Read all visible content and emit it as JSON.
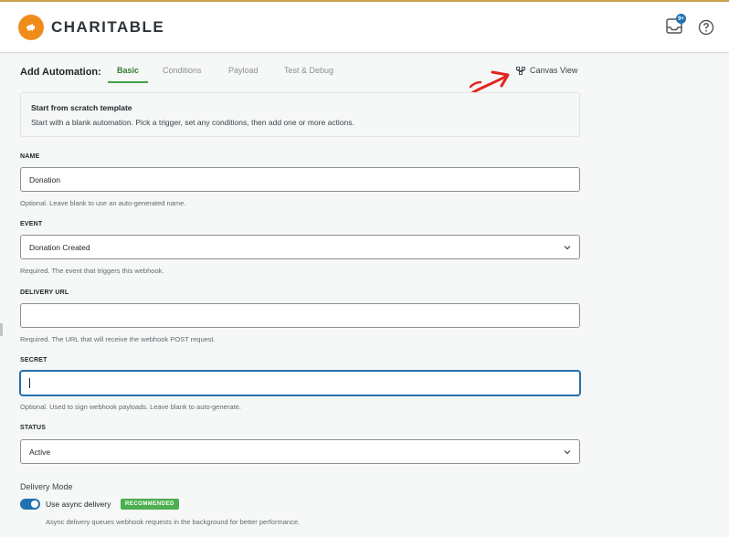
{
  "brand": {
    "name": "CHARITABLE",
    "accent": "#f08c1a"
  },
  "header": {
    "notification_count": "9+",
    "inbox_icon": "inbox-icon",
    "help_icon": "help-circle-icon"
  },
  "page": {
    "title": "Add Automation:",
    "tabs": [
      {
        "label": "Basic",
        "active": true
      },
      {
        "label": "Conditions",
        "active": false
      },
      {
        "label": "Payload",
        "active": false
      },
      {
        "label": "Test & Debug",
        "active": false
      }
    ],
    "canvas_view_label": "Canvas View"
  },
  "template": {
    "title": "Start from scratch template",
    "description": "Start with a blank automation. Pick a trigger, set any conditions, then add one or more actions."
  },
  "form": {
    "name": {
      "label": "NAME",
      "value": "Donation",
      "help": "Optional. Leave blank to use an auto-generated name."
    },
    "event": {
      "label": "EVENT",
      "value": "Donation Created",
      "help": "Required. The event that triggers this webhook."
    },
    "delivery_url": {
      "label": "DELIVERY URL",
      "value": "",
      "help": "Required. The URL that will receive the webhook POST request."
    },
    "secret": {
      "label": "SECRET",
      "value": "",
      "help": "Optional. Used to sign webhook payloads. Leave blank to auto-generate."
    },
    "status": {
      "label": "STATUS",
      "value": "Active"
    }
  },
  "delivery_mode": {
    "label": "Delivery Mode",
    "toggle_label": "Use async delivery",
    "toggle_on": true,
    "badge": "RECOMMENDED",
    "help": "Async delivery queues webhook requests in the background for better performance."
  }
}
